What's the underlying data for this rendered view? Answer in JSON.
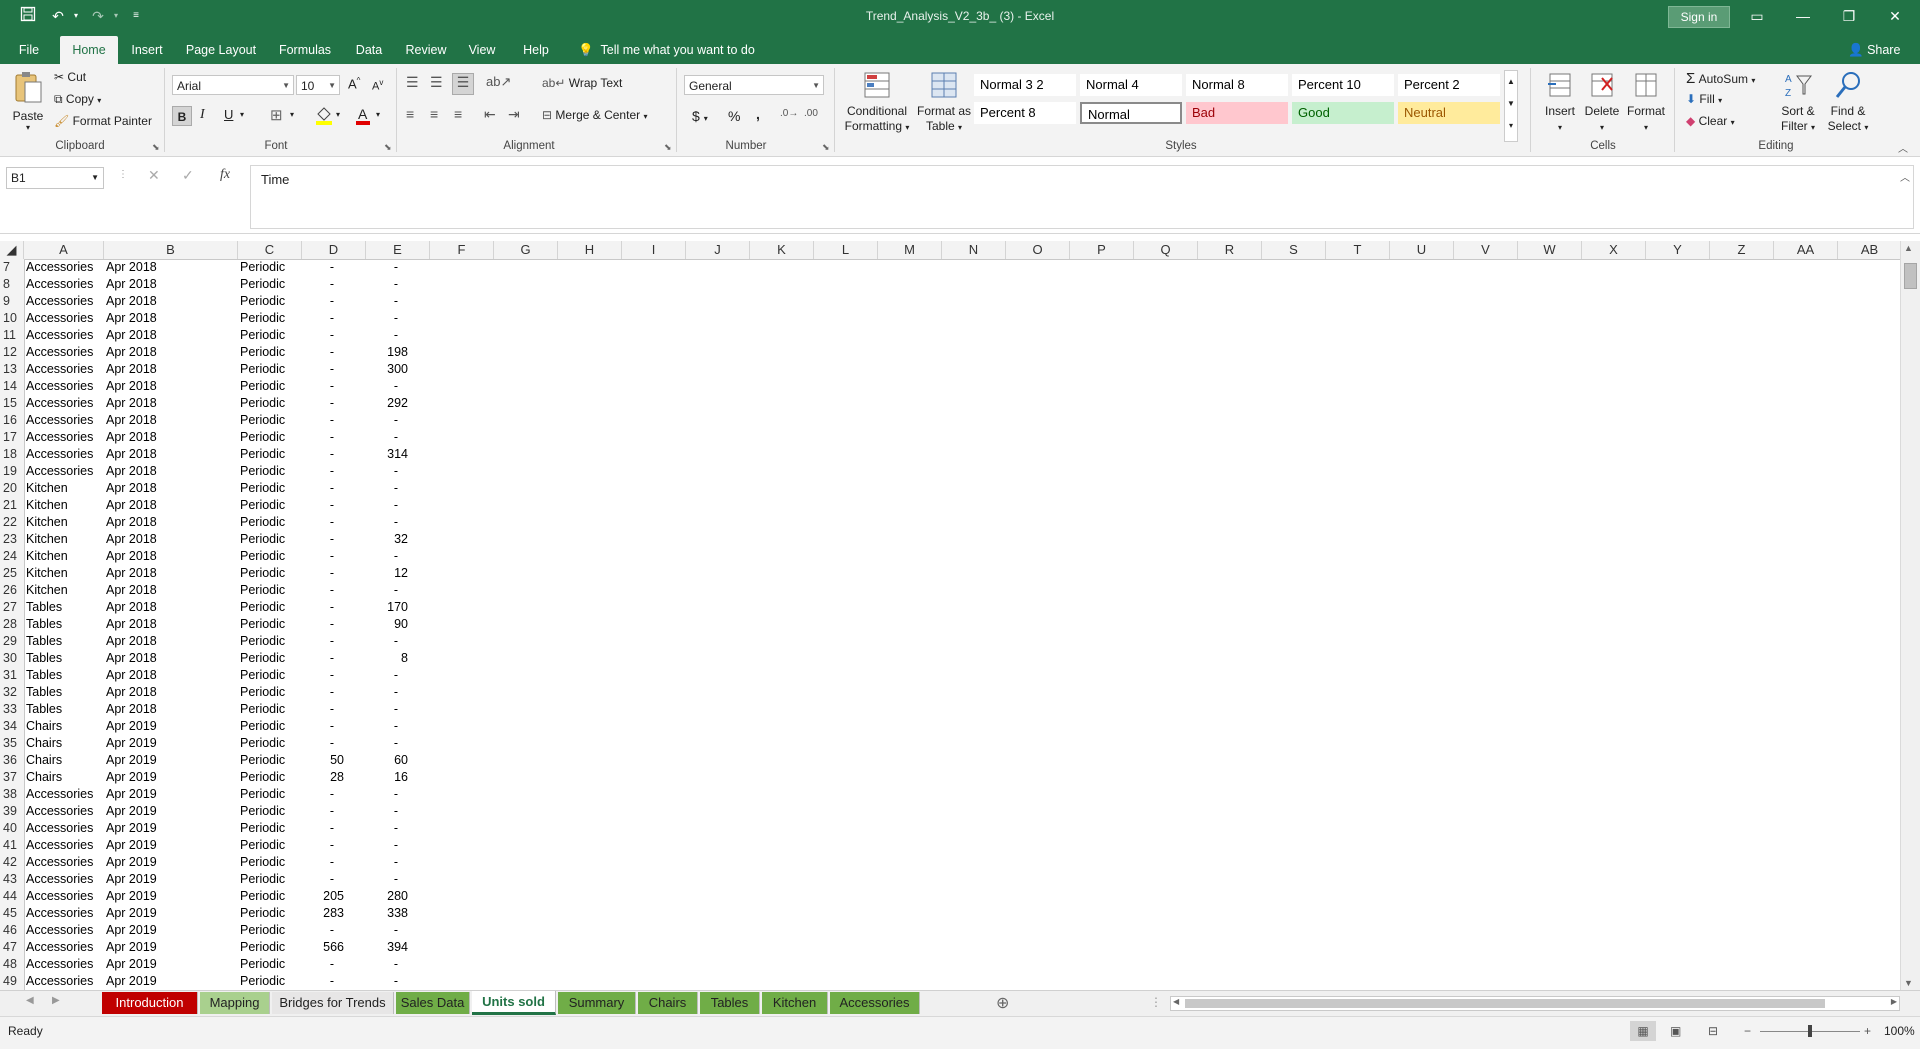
{
  "window": {
    "title": "Trend_Analysis_V2_3b_ (3)  -  Excel",
    "sign_in": "Sign in"
  },
  "ribbon_tabs": [
    "File",
    "Home",
    "Insert",
    "Page Layout",
    "Formulas",
    "Data",
    "Review",
    "View",
    "Help"
  ],
  "active_tab": "Home",
  "tell_me": "Tell me what you want to do",
  "share": "Share",
  "clipboard": {
    "paste": "Paste",
    "cut": "Cut",
    "copy": "Copy",
    "format_painter": "Format Painter",
    "label": "Clipboard"
  },
  "font": {
    "name": "Arial",
    "size": "10",
    "bold": "B",
    "italic": "I",
    "underline": "U",
    "label": "Font"
  },
  "alignment": {
    "wrap_text": "Wrap Text",
    "merge_center": "Merge & Center",
    "label": "Alignment"
  },
  "number": {
    "format": "General",
    "currency": "$",
    "percent": "%",
    "comma": ",",
    "label": "Number"
  },
  "styles": {
    "conditional_formatting": [
      "Conditional",
      "Formatting"
    ],
    "format_as_table": [
      "Format as",
      "Table"
    ],
    "items": [
      {
        "label": "Normal 3 2",
        "bg": "#ffffff",
        "color": "#000000",
        "border": "none"
      },
      {
        "label": "Normal 4",
        "bg": "#ffffff",
        "color": "#000000",
        "border": "none"
      },
      {
        "label": "Normal 8",
        "bg": "#ffffff",
        "color": "#000000",
        "border": "none"
      },
      {
        "label": "Percent 10",
        "bg": "#ffffff",
        "color": "#000000",
        "border": "none"
      },
      {
        "label": "Percent 2",
        "bg": "#ffffff",
        "color": "#000000",
        "border": "none"
      },
      {
        "label": "Percent 8",
        "bg": "#ffffff",
        "color": "#000000",
        "border": "none"
      },
      {
        "label": "Normal",
        "bg": "#ffffff",
        "color": "#000000",
        "border": "selected"
      },
      {
        "label": "Bad",
        "bg": "#ffc7ce",
        "color": "#9c0006",
        "border": "none"
      },
      {
        "label": "Good",
        "bg": "#c6efce",
        "color": "#006100",
        "border": "none"
      },
      {
        "label": "Neutral",
        "bg": "#ffeb9c",
        "color": "#9c5700",
        "border": "none"
      }
    ],
    "label": "Styles"
  },
  "cells_group": {
    "insert": "Insert",
    "delete": "Delete",
    "format": "Format",
    "label": "Cells"
  },
  "editing": {
    "autosum": "AutoSum",
    "fill": "Fill",
    "clear": "Clear",
    "sort_filter": [
      "Sort &",
      "Filter"
    ],
    "find_select": [
      "Find &",
      "Select"
    ],
    "label": "Editing"
  },
  "formula_bar": {
    "name_box": "B1",
    "formula": "Time"
  },
  "columns": [
    "A",
    "B",
    "C",
    "D",
    "E",
    "F",
    "G",
    "H",
    "I",
    "J",
    "K",
    "L",
    "M",
    "N",
    "O",
    "P",
    "Q",
    "R",
    "S",
    "T",
    "U",
    "V",
    "W",
    "X",
    "Y",
    "Z",
    "AA",
    "AB"
  ],
  "rows": [
    {
      "n": "7",
      "a": "Accessories",
      "b": "Apr 2018",
      "c": "Periodic",
      "d": "-",
      "e": "-"
    },
    {
      "n": "8",
      "a": "Accessories",
      "b": "Apr 2018",
      "c": "Periodic",
      "d": "-",
      "e": "-"
    },
    {
      "n": "9",
      "a": "Accessories",
      "b": "Apr 2018",
      "c": "Periodic",
      "d": "-",
      "e": "-"
    },
    {
      "n": "10",
      "a": "Accessories",
      "b": "Apr 2018",
      "c": "Periodic",
      "d": "-",
      "e": "-"
    },
    {
      "n": "11",
      "a": "Accessories",
      "b": "Apr 2018",
      "c": "Periodic",
      "d": "-",
      "e": "-"
    },
    {
      "n": "12",
      "a": "Accessories",
      "b": "Apr 2018",
      "c": "Periodic",
      "d": "-",
      "e": "198"
    },
    {
      "n": "13",
      "a": "Accessories",
      "b": "Apr 2018",
      "c": "Periodic",
      "d": "-",
      "e": "300"
    },
    {
      "n": "14",
      "a": "Accessories",
      "b": "Apr 2018",
      "c": "Periodic",
      "d": "-",
      "e": "-"
    },
    {
      "n": "15",
      "a": "Accessories",
      "b": "Apr 2018",
      "c": "Periodic",
      "d": "-",
      "e": "292"
    },
    {
      "n": "16",
      "a": "Accessories",
      "b": "Apr 2018",
      "c": "Periodic",
      "d": "-",
      "e": "-"
    },
    {
      "n": "17",
      "a": "Accessories",
      "b": "Apr 2018",
      "c": "Periodic",
      "d": "-",
      "e": "-"
    },
    {
      "n": "18",
      "a": "Accessories",
      "b": "Apr 2018",
      "c": "Periodic",
      "d": "-",
      "e": "314"
    },
    {
      "n": "19",
      "a": "Accessories",
      "b": "Apr 2018",
      "c": "Periodic",
      "d": "-",
      "e": "-"
    },
    {
      "n": "20",
      "a": "Kitchen",
      "b": "Apr 2018",
      "c": "Periodic",
      "d": "-",
      "e": "-"
    },
    {
      "n": "21",
      "a": "Kitchen",
      "b": "Apr 2018",
      "c": "Periodic",
      "d": "-",
      "e": "-"
    },
    {
      "n": "22",
      "a": "Kitchen",
      "b": "Apr 2018",
      "c": "Periodic",
      "d": "-",
      "e": "-"
    },
    {
      "n": "23",
      "a": "Kitchen",
      "b": "Apr 2018",
      "c": "Periodic",
      "d": "-",
      "e": "32"
    },
    {
      "n": "24",
      "a": "Kitchen",
      "b": "Apr 2018",
      "c": "Periodic",
      "d": "-",
      "e": "-"
    },
    {
      "n": "25",
      "a": "Kitchen",
      "b": "Apr 2018",
      "c": "Periodic",
      "d": "-",
      "e": "12"
    },
    {
      "n": "26",
      "a": "Kitchen",
      "b": "Apr 2018",
      "c": "Periodic",
      "d": "-",
      "e": "-"
    },
    {
      "n": "27",
      "a": "Tables",
      "b": "Apr 2018",
      "c": "Periodic",
      "d": "-",
      "e": "170"
    },
    {
      "n": "28",
      "a": "Tables",
      "b": "Apr 2018",
      "c": "Periodic",
      "d": "-",
      "e": "90"
    },
    {
      "n": "29",
      "a": "Tables",
      "b": "Apr 2018",
      "c": "Periodic",
      "d": "-",
      "e": "-"
    },
    {
      "n": "30",
      "a": "Tables",
      "b": "Apr 2018",
      "c": "Periodic",
      "d": "-",
      "e": "8"
    },
    {
      "n": "31",
      "a": "Tables",
      "b": "Apr 2018",
      "c": "Periodic",
      "d": "-",
      "e": "-"
    },
    {
      "n": "32",
      "a": "Tables",
      "b": "Apr 2018",
      "c": "Periodic",
      "d": "-",
      "e": "-"
    },
    {
      "n": "33",
      "a": "Tables",
      "b": "Apr 2018",
      "c": "Periodic",
      "d": "-",
      "e": "-"
    },
    {
      "n": "34",
      "a": "Chairs",
      "b": "Apr 2019",
      "c": "Periodic",
      "d": "-",
      "e": "-"
    },
    {
      "n": "35",
      "a": "Chairs",
      "b": "Apr 2019",
      "c": "Periodic",
      "d": "-",
      "e": "-"
    },
    {
      "n": "36",
      "a": "Chairs",
      "b": "Apr 2019",
      "c": "Periodic",
      "d": "50",
      "e": "60"
    },
    {
      "n": "37",
      "a": "Chairs",
      "b": "Apr 2019",
      "c": "Periodic",
      "d": "28",
      "e": "16"
    },
    {
      "n": "38",
      "a": "Accessories",
      "b": "Apr 2019",
      "c": "Periodic",
      "d": "-",
      "e": "-"
    },
    {
      "n": "39",
      "a": "Accessories",
      "b": "Apr 2019",
      "c": "Periodic",
      "d": "-",
      "e": "-"
    },
    {
      "n": "40",
      "a": "Accessories",
      "b": "Apr 2019",
      "c": "Periodic",
      "d": "-",
      "e": "-"
    },
    {
      "n": "41",
      "a": "Accessories",
      "b": "Apr 2019",
      "c": "Periodic",
      "d": "-",
      "e": "-"
    },
    {
      "n": "42",
      "a": "Accessories",
      "b": "Apr 2019",
      "c": "Periodic",
      "d": "-",
      "e": "-"
    },
    {
      "n": "43",
      "a": "Accessories",
      "b": "Apr 2019",
      "c": "Periodic",
      "d": "-",
      "e": "-"
    },
    {
      "n": "44",
      "a": "Accessories",
      "b": "Apr 2019",
      "c": "Periodic",
      "d": "205",
      "e": "280"
    },
    {
      "n": "45",
      "a": "Accessories",
      "b": "Apr 2019",
      "c": "Periodic",
      "d": "283",
      "e": "338"
    },
    {
      "n": "46",
      "a": "Accessories",
      "b": "Apr 2019",
      "c": "Periodic",
      "d": "-",
      "e": "-"
    },
    {
      "n": "47",
      "a": "Accessories",
      "b": "Apr 2019",
      "c": "Periodic",
      "d": "566",
      "e": "394"
    },
    {
      "n": "48",
      "a": "Accessories",
      "b": "Apr 2019",
      "c": "Periodic",
      "d": "-",
      "e": "-"
    },
    {
      "n": "49",
      "a": "Accessories",
      "b": "Apr 2019",
      "c": "Periodic",
      "d": "-",
      "e": "-"
    }
  ],
  "sheet_tabs": [
    {
      "label": "Introduction",
      "bg": "#c00000",
      "color": "#ffffff",
      "active": false
    },
    {
      "label": "Mapping",
      "bg": "#a9d08e",
      "color": "#222222",
      "active": false
    },
    {
      "label": "Bridges for Trends",
      "bg": "#e7e6e6",
      "color": "#222222",
      "active": false
    },
    {
      "label": "Sales Data",
      "bg": "#70ad47",
      "color": "#222222",
      "active": false
    },
    {
      "label": "Units sold",
      "bg": "#ffffff",
      "color": "#217346",
      "active": true
    },
    {
      "label": "Summary",
      "bg": "#70ad47",
      "color": "#222222",
      "active": false
    },
    {
      "label": "Chairs",
      "bg": "#70ad47",
      "color": "#222222",
      "active": false
    },
    {
      "label": "Tables",
      "bg": "#70ad47",
      "color": "#222222",
      "active": false
    },
    {
      "label": "Kitchen",
      "bg": "#70ad47",
      "color": "#222222",
      "active": false
    },
    {
      "label": "Accessories",
      "bg": "#70ad47",
      "color": "#222222",
      "active": false
    }
  ],
  "status": {
    "ready": "Ready",
    "zoom": "100%"
  },
  "colors": {
    "excel_green": "#217346"
  }
}
